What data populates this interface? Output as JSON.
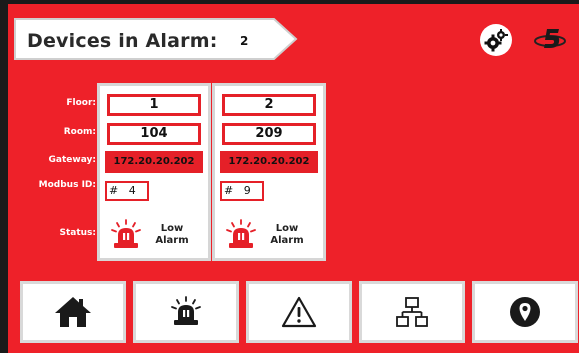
{
  "header": {
    "title": "Devices in Alarm:",
    "alarm_count": "2",
    "settings_icon": "gears-icon",
    "logo_icon": "brand-logo-icon"
  },
  "labels": {
    "floor": "Floor:",
    "room": "Room:",
    "gateway": "Gateway:",
    "modbus_id": "Modbus ID:",
    "status": "Status:"
  },
  "devices": [
    {
      "floor": "1",
      "room": "104",
      "gateway": "172.20.20.202",
      "modbus_id": "#   4",
      "status_line1": "Low",
      "status_line2": "Alarm",
      "status_icon": "alarm-siren-icon"
    },
    {
      "floor": "2",
      "room": "209",
      "gateway": "172.20.20.202",
      "modbus_id": "#   9",
      "status_line1": "Low",
      "status_line2": "Alarm",
      "status_icon": "alarm-siren-icon"
    }
  ],
  "nav": [
    {
      "icon": "home-icon"
    },
    {
      "icon": "alarm-siren-icon"
    },
    {
      "icon": "warning-icon"
    },
    {
      "icon": "network-icon"
    },
    {
      "icon": "location-pin-icon"
    }
  ],
  "colors": {
    "background_red": "#ee2129",
    "box_border_red": "#e52028",
    "card_border_gray": "#d6d6d6",
    "text_dark": "#2a2a2a"
  }
}
